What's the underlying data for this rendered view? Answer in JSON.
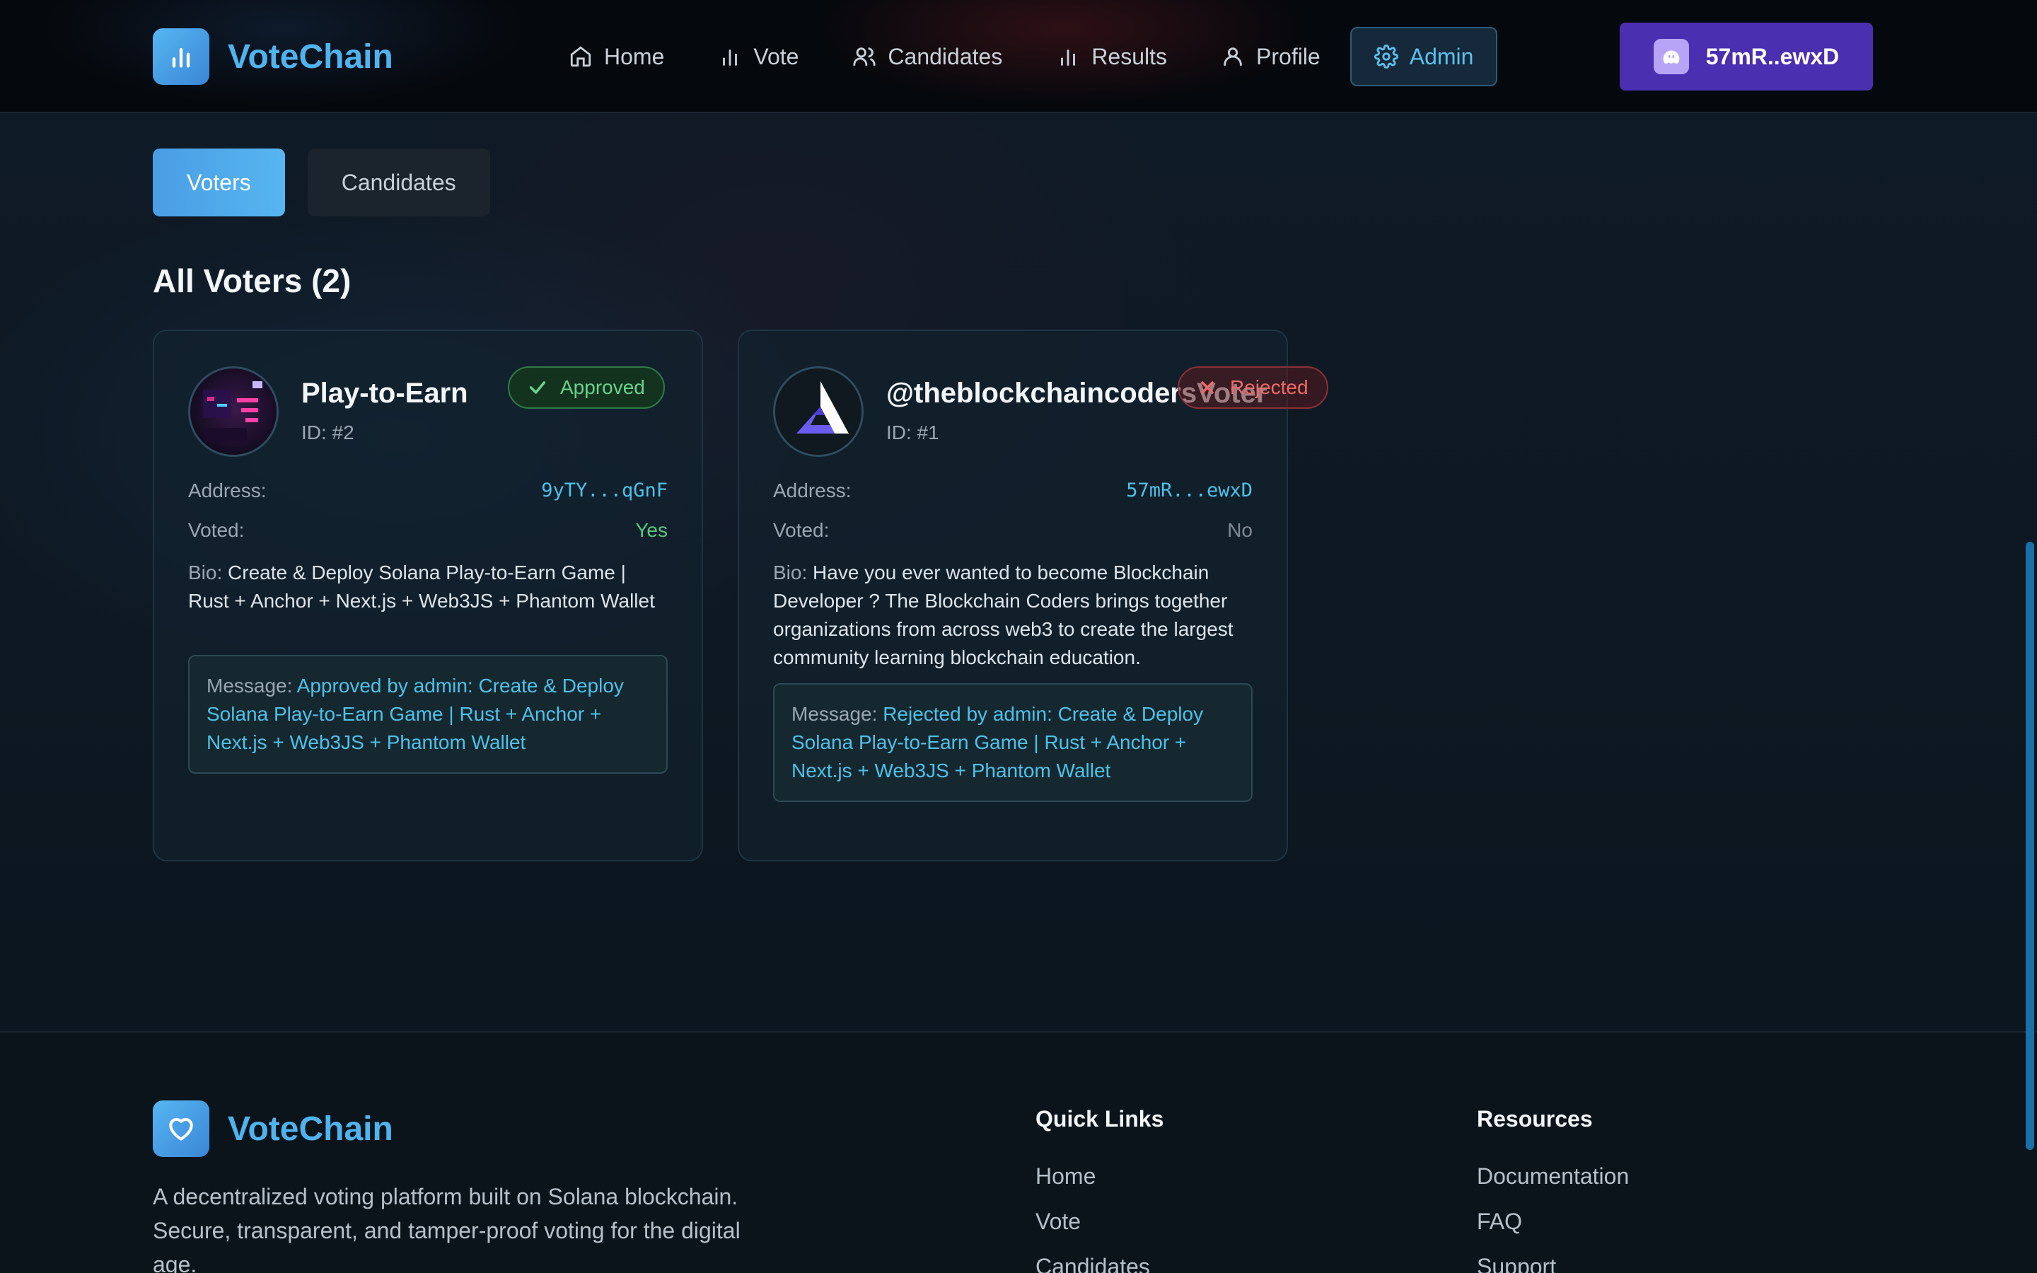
{
  "app": {
    "name": "VoteChain"
  },
  "nav": {
    "items": [
      {
        "label": "Home",
        "icon": "home-icon"
      },
      {
        "label": "Vote",
        "icon": "bar-chart-icon"
      },
      {
        "label": "Candidates",
        "icon": "users-icon"
      },
      {
        "label": "Results",
        "icon": "bar-chart-icon"
      },
      {
        "label": "Profile",
        "icon": "user-icon"
      },
      {
        "label": "Admin",
        "icon": "gear-icon",
        "active": true
      }
    ]
  },
  "wallet": {
    "label": "57mR..ewxD",
    "icon": "phantom-ghost-icon"
  },
  "tabs": [
    {
      "label": "Voters",
      "active": true
    },
    {
      "label": "Candidates",
      "active": false
    }
  ],
  "section": {
    "title": "All Voters (2)"
  },
  "voters": [
    {
      "name": "Play-to-Earn",
      "id": "ID: #2",
      "status": "Approved",
      "address_label": "Address:",
      "address": "9yTY...qGnF",
      "voted_label": "Voted:",
      "voted": "Yes",
      "bio_label": "Bio:",
      "bio": "Create & Deploy Solana Play-to-Earn Game | Rust + Anchor + Next.js + Web3JS + Phantom Wallet",
      "message_label": "Message:",
      "message": "Approved by admin: Create & Deploy Solana Play-to-Earn Game | Rust + Anchor + Next.js + Web3JS + Phantom Wallet"
    },
    {
      "name": "@theblockchaincodersVoter",
      "id": "ID: #1",
      "status": "Rejected",
      "address_label": "Address:",
      "address": "57mR...ewxD",
      "voted_label": "Voted:",
      "voted": "No",
      "bio_label": "Bio:",
      "bio": "Have you ever wanted to become Blockchain Developer ? The Blockchain Coders brings together organizations from across web3 to create the largest community learning blockchain education.",
      "message_label": "Message:",
      "message": "Rejected by admin: Create & Deploy Solana Play-to-Earn Game | Rust + Anchor + Next.js + Web3JS + Phantom Wallet"
    }
  ],
  "footer": {
    "brand": "VoteChain",
    "description": "A decentralized voting platform built on Solana blockchain. Secure, transparent, and tamper-proof voting for the digital age.",
    "quick_links": {
      "title": "Quick Links",
      "items": [
        "Home",
        "Vote",
        "Candidates"
      ]
    },
    "resources": {
      "title": "Resources",
      "items": [
        "Documentation",
        "FAQ",
        "Support"
      ]
    }
  },
  "colors": {
    "accent": "#4fb3ee",
    "wallet": "#4a2fb0",
    "approved": "#6ad28c",
    "rejected": "#ee6a6a"
  }
}
